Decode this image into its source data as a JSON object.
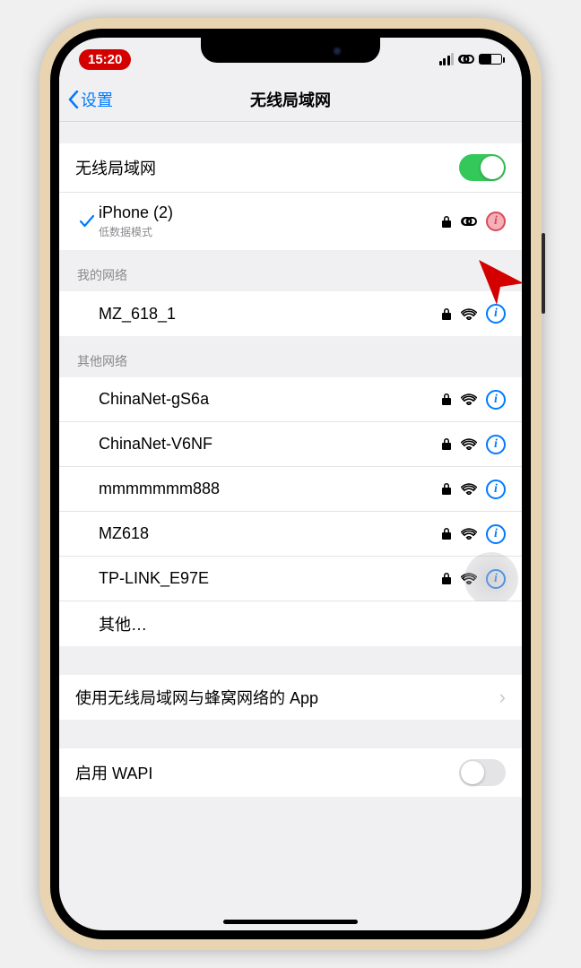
{
  "status": {
    "time": "15:20"
  },
  "nav": {
    "back": "设置",
    "title": "无线局域网"
  },
  "wifi": {
    "label": "无线局域网",
    "enabled": true,
    "connected": {
      "name": "iPhone (2)",
      "sub": "低数据模式"
    }
  },
  "my_networks": {
    "header": "我的网络",
    "items": [
      "MZ_618_1"
    ]
  },
  "other_networks": {
    "header": "其他网络",
    "items": [
      "ChinaNet-gS6a",
      "ChinaNet-V6NF",
      "mmmmmmm888",
      "MZ618",
      "TP-LINK_E97E"
    ],
    "other_label": "其他…"
  },
  "apps_row": "使用无线局域网与蜂窝网络的 App",
  "wapi": {
    "label": "启用 WAPI",
    "enabled": false
  }
}
